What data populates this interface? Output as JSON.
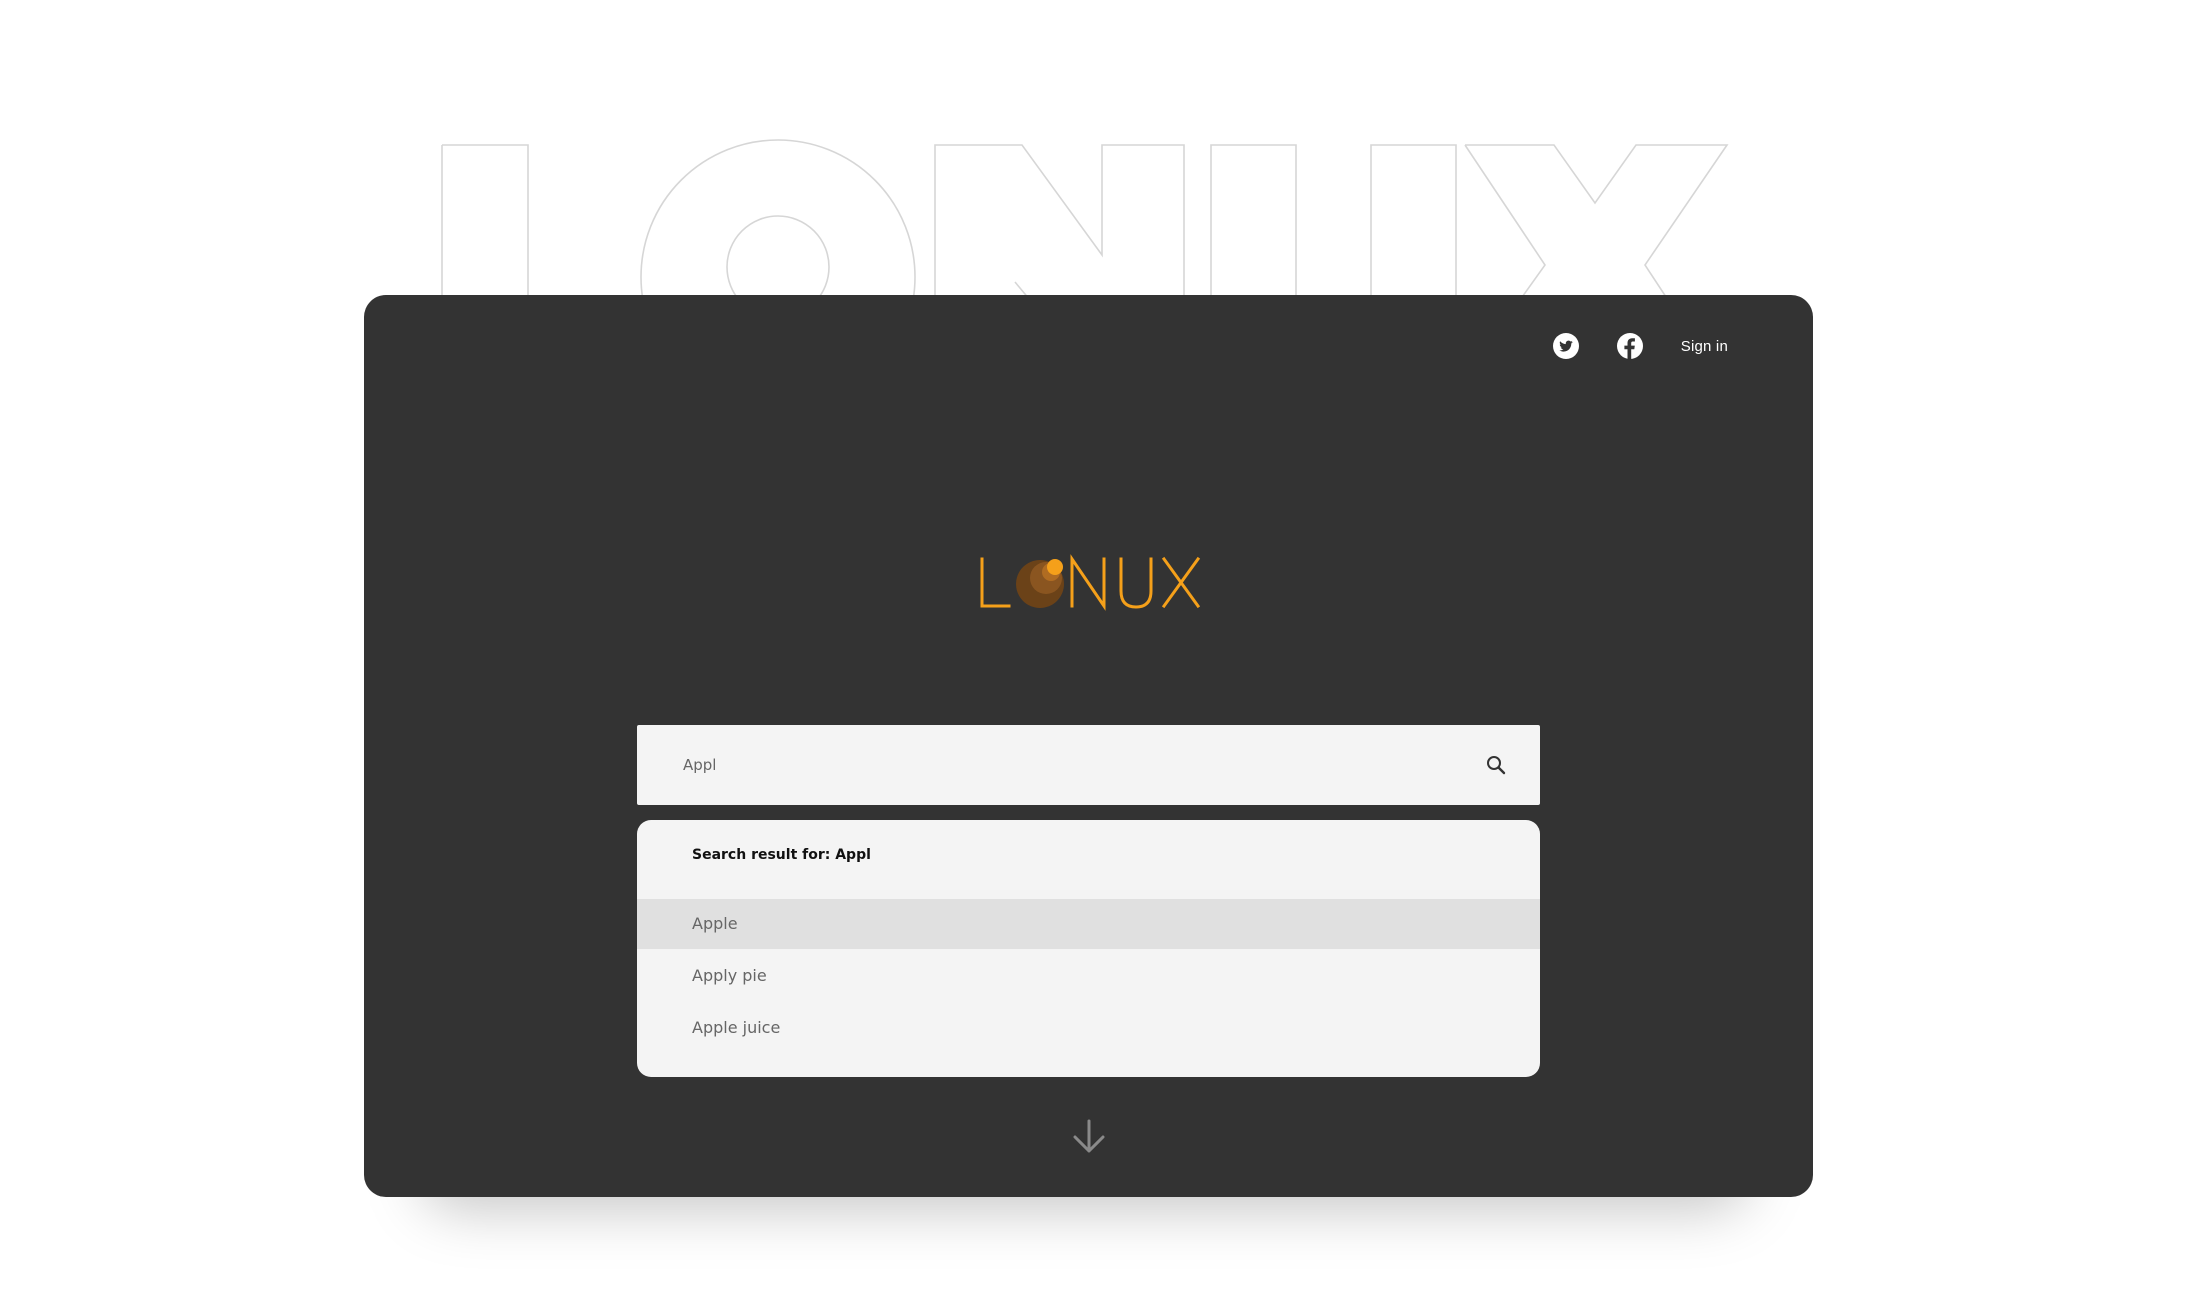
{
  "background_word": "LONUX",
  "brand": {
    "name": "LONUX",
    "accent_color": "#f5a01a",
    "card_color": "#333333"
  },
  "nav": {
    "twitter_icon": "twitter-icon",
    "facebook_icon": "facebook-icon",
    "signin_label": "Sign in"
  },
  "search": {
    "value": "Appl",
    "icon": "search-icon"
  },
  "results": {
    "heading": "Search result for: Appl",
    "items": [
      {
        "label": "Apple",
        "highlighted": true
      },
      {
        "label": "Apply pie",
        "highlighted": false
      },
      {
        "label": "Apple juice",
        "highlighted": false
      }
    ]
  },
  "scroll_icon": "arrow-down-icon"
}
